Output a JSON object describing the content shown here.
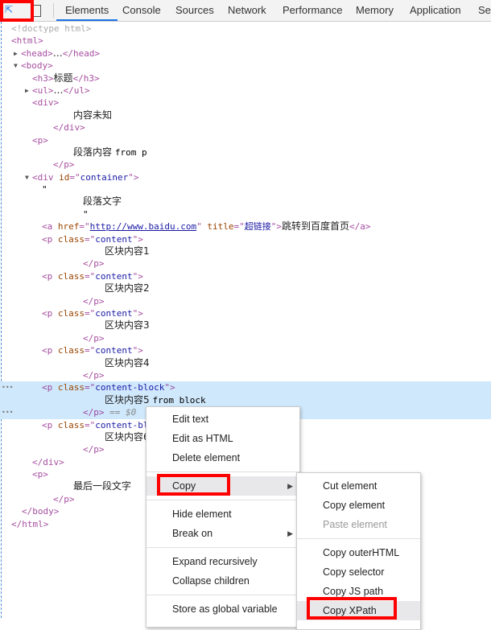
{
  "tabs": [
    "Elements",
    "Console",
    "Sources",
    "Network",
    "Performance",
    "Memory",
    "Application",
    "Se"
  ],
  "active_tab": "Elements",
  "tree": [
    {
      "indent": 14,
      "segs": [
        [
          "dim",
          "<!doctype html>"
        ]
      ]
    },
    {
      "indent": 14,
      "segs": [
        [
          "tag",
          "<html>"
        ]
      ]
    },
    {
      "indent": 26,
      "tri": "▶",
      "segs": [
        [
          "tag",
          "<head>"
        ],
        [
          "text",
          "…"
        ],
        [
          "tag",
          "</head>"
        ]
      ]
    },
    {
      "indent": 26,
      "tri": "▼",
      "segs": [
        [
          "tag",
          "<body>"
        ]
      ]
    },
    {
      "indent": 40,
      "segs": [
        [
          "tag",
          "<h3>"
        ],
        [
          "text",
          "标题"
        ],
        [
          "tag",
          "</h3>"
        ]
      ]
    },
    {
      "indent": 40,
      "tri": "▶",
      "segs": [
        [
          "tag",
          "<ul>"
        ],
        [
          "text",
          "…"
        ],
        [
          "tag",
          "</ul>"
        ]
      ]
    },
    {
      "indent": 40,
      "segs": [
        [
          "tag",
          "<div>"
        ]
      ]
    },
    {
      "indent": 91,
      "segs": [
        [
          "text",
          "内容未知"
        ]
      ]
    },
    {
      "indent": 66,
      "segs": [
        [
          "tag",
          "</div>"
        ]
      ]
    },
    {
      "indent": 40,
      "segs": [
        [
          "tag",
          "<p>"
        ]
      ]
    },
    {
      "indent": 91,
      "segs": [
        [
          "text",
          "段落内容 "
        ],
        [
          "plain",
          "from p"
        ]
      ]
    },
    {
      "indent": 66,
      "segs": [
        [
          "tag",
          "</p>"
        ]
      ]
    },
    {
      "indent": 40,
      "tri": "▼",
      "segs": [
        [
          "tag",
          "<div "
        ],
        [
          "attr",
          "id"
        ],
        [
          "tag",
          "=\""
        ],
        [
          "val",
          "container"
        ],
        [
          "tag",
          "\">"
        ]
      ]
    },
    {
      "indent": 52,
      "segs": [
        [
          "plain",
          "\""
        ]
      ]
    },
    {
      "indent": 103,
      "segs": [
        [
          "text",
          "段落文字"
        ]
      ]
    },
    {
      "indent": 103,
      "segs": [
        [
          "plain",
          "\""
        ]
      ]
    },
    {
      "indent": 52,
      "segs": [
        [
          "tag",
          "<a "
        ],
        [
          "attr",
          "href"
        ],
        [
          "tag",
          "=\""
        ],
        [
          "link",
          "http://www.baidu.com"
        ],
        [
          "tag",
          "\" "
        ],
        [
          "attr",
          "title"
        ],
        [
          "tag",
          "=\""
        ],
        [
          "val",
          "超链接"
        ],
        [
          "tag",
          "\">"
        ],
        [
          "text",
          "跳转到百度首页"
        ],
        [
          "tag",
          "</a>"
        ]
      ]
    },
    {
      "indent": 52,
      "segs": [
        [
          "tag",
          "<p "
        ],
        [
          "attr",
          "class"
        ],
        [
          "tag",
          "=\""
        ],
        [
          "val",
          "content"
        ],
        [
          "tag",
          "\">"
        ]
      ]
    },
    {
      "indent": 130,
      "segs": [
        [
          "text",
          "区块内容1"
        ]
      ]
    },
    {
      "indent": 103,
      "segs": [
        [
          "tag",
          "</p>"
        ]
      ]
    },
    {
      "indent": 52,
      "segs": [
        [
          "tag",
          "<p "
        ],
        [
          "attr",
          "class"
        ],
        [
          "tag",
          "=\""
        ],
        [
          "val",
          "content"
        ],
        [
          "tag",
          "\">"
        ]
      ]
    },
    {
      "indent": 130,
      "segs": [
        [
          "text",
          "区块内容2"
        ]
      ]
    },
    {
      "indent": 103,
      "segs": [
        [
          "tag",
          "</p>"
        ]
      ]
    },
    {
      "indent": 52,
      "segs": [
        [
          "tag",
          "<p "
        ],
        [
          "attr",
          "class"
        ],
        [
          "tag",
          "=\""
        ],
        [
          "val",
          "content"
        ],
        [
          "tag",
          "\">"
        ]
      ]
    },
    {
      "indent": 130,
      "segs": [
        [
          "text",
          "区块内容3"
        ]
      ]
    },
    {
      "indent": 103,
      "segs": [
        [
          "tag",
          "</p>"
        ]
      ]
    },
    {
      "indent": 52,
      "segs": [
        [
          "tag",
          "<p "
        ],
        [
          "attr",
          "class"
        ],
        [
          "tag",
          "=\""
        ],
        [
          "val",
          "content"
        ],
        [
          "tag",
          "\">"
        ]
      ]
    },
    {
      "indent": 130,
      "segs": [
        [
          "text",
          "区块内容4"
        ]
      ]
    },
    {
      "indent": 103,
      "segs": [
        [
          "tag",
          "</p>"
        ]
      ]
    },
    {
      "indent": 52,
      "sel": true,
      "segs": [
        [
          "tag",
          "<p "
        ],
        [
          "attr",
          "class"
        ],
        [
          "tag",
          "=\""
        ],
        [
          "val",
          "content-block"
        ],
        [
          "tag",
          "\">"
        ]
      ]
    },
    {
      "indent": 130,
      "sel": true,
      "segs": [
        [
          "text",
          "区块内容5 "
        ],
        [
          "plain",
          "from block"
        ]
      ]
    },
    {
      "indent": 103,
      "sel": true,
      "segs": [
        [
          "tag",
          "</p>"
        ],
        [
          "eq",
          " == $0"
        ]
      ]
    },
    {
      "indent": 52,
      "segs": [
        [
          "tag",
          "<p "
        ],
        [
          "attr",
          "class"
        ],
        [
          "tag",
          "=\""
        ],
        [
          "val",
          "content-block"
        ],
        [
          "tag",
          "\">"
        ]
      ]
    },
    {
      "indent": 130,
      "segs": [
        [
          "text",
          "区块内容6"
        ]
      ]
    },
    {
      "indent": 103,
      "segs": [
        [
          "tag",
          "</p>"
        ]
      ]
    },
    {
      "indent": 40,
      "segs": [
        [
          "tag",
          "</div>"
        ]
      ]
    },
    {
      "indent": 40,
      "segs": [
        [
          "tag",
          "<p>"
        ]
      ]
    },
    {
      "indent": 91,
      "segs": [
        [
          "text",
          "最后一段文字"
        ]
      ]
    },
    {
      "indent": 66,
      "segs": [
        [
          "tag",
          "</p>"
        ]
      ]
    },
    {
      "indent": 27,
      "segs": [
        [
          "tag",
          "</body>"
        ]
      ]
    },
    {
      "indent": 14,
      "segs": [
        [
          "tag",
          "</html>"
        ]
      ]
    }
  ],
  "context_menu": {
    "items": [
      {
        "label": "Edit text"
      },
      {
        "label": "Edit as HTML"
      },
      {
        "label": "Delete element"
      },
      {
        "sep": true
      },
      {
        "label": "Copy",
        "submenu": true,
        "hover": true
      },
      {
        "sep": true
      },
      {
        "label": "Hide element"
      },
      {
        "label": "Break on",
        "submenu": true
      },
      {
        "sep": true
      },
      {
        "label": "Expand recursively"
      },
      {
        "label": "Collapse children"
      },
      {
        "sep": true
      },
      {
        "label": "Store as global variable"
      }
    ]
  },
  "copy_submenu": {
    "items": [
      {
        "label": "Cut element"
      },
      {
        "label": "Copy element"
      },
      {
        "label": "Paste element",
        "disabled": true
      },
      {
        "sep": true
      },
      {
        "label": "Copy outerHTML"
      },
      {
        "label": "Copy selector"
      },
      {
        "label": "Copy JS path"
      },
      {
        "label": "Copy XPath",
        "hover": true
      }
    ]
  },
  "colors": {
    "accent": "#1a73e8",
    "highlight": "#ff0000",
    "selection": "#cfe8fc"
  }
}
